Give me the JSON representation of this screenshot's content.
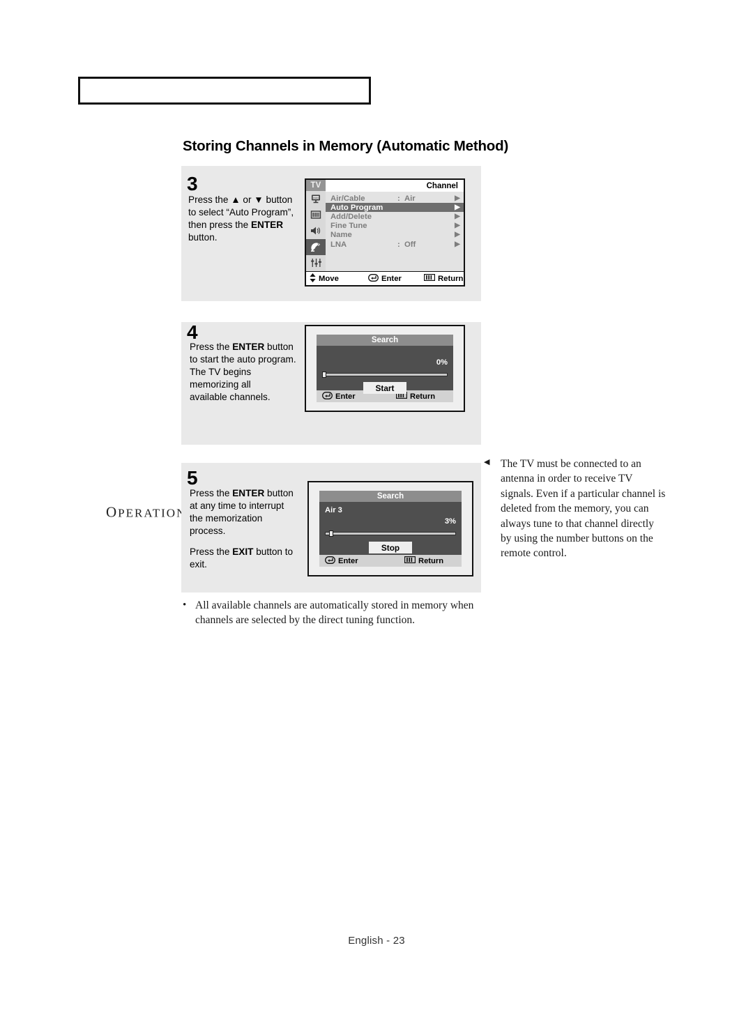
{
  "chapter": {
    "label": "OPERATION",
    "first_letter": "O",
    "rest": "PERATION"
  },
  "section": {
    "heading": "Storing Channels in Memory (Automatic Method)"
  },
  "steps": [
    {
      "number": "3",
      "lines": [
        "Press the ▲ or ▼ button",
        "to select “Auto Program”,",
        "then press the ENTER",
        "button."
      ]
    },
    {
      "number": "4",
      "lines": [
        "Press the ENTER button",
        "to start the auto program.",
        "The TV begins",
        "memorizing all",
        "available channels."
      ]
    },
    {
      "number": "5",
      "lines": [
        "Press the ENTER button",
        "at any time to interrupt",
        "the memorization",
        "process.",
        "",
        "Press the EXIT button to",
        "exit."
      ]
    }
  ],
  "osd_channel": {
    "tv_tag": "TV",
    "title": "Channel",
    "sidebar_icons": [
      "input-source-icon",
      "picture-icon",
      "sound-icon",
      "channel-dish-icon",
      "setup-sliders-icon"
    ],
    "selected_icon_index": 3,
    "rows": [
      {
        "label": "Air/Cable",
        "colon": ":",
        "value": "Air",
        "arrow": "▶",
        "highlighted": false
      },
      {
        "label": "Auto Program",
        "colon": "",
        "value": "",
        "arrow": "▶",
        "highlighted": true
      },
      {
        "label": "Add/Delete",
        "colon": "",
        "value": "",
        "arrow": "▶",
        "highlighted": false
      },
      {
        "label": "Fine Tune",
        "colon": "",
        "value": "",
        "arrow": "▶",
        "highlighted": false
      },
      {
        "label": "Name",
        "colon": "",
        "value": "",
        "arrow": "▶",
        "highlighted": false
      },
      {
        "label": "LNA",
        "colon": ":",
        "value": "Off",
        "arrow": "▶",
        "highlighted": false
      }
    ],
    "footer": {
      "move": "Move",
      "enter": "Enter",
      "return": "Return"
    }
  },
  "osd_search_start": {
    "title": "Search",
    "channel": "",
    "percent": "0%",
    "progress_value": 0,
    "button": "Start",
    "footer": {
      "enter": "Enter",
      "return": "Return"
    }
  },
  "osd_search_stop": {
    "title": "Search",
    "channel": "Air 3",
    "percent": "3%",
    "progress_value": 3,
    "button": "Stop",
    "footer": {
      "enter": "Enter",
      "return": "Return"
    }
  },
  "note_right": {
    "marker": "◀",
    "text": "The TV must be connected to an antenna in order to receive TV signals. Even if a particular channel is deleted from the memory, you can always tune to that channel directly by using the number buttons on the remote control."
  },
  "note_bullet": {
    "marker": "•",
    "text": "All available channels are automatically stored in memory when channels are selected by the direct tuning function."
  },
  "footer": {
    "page_label": "English - 23"
  },
  "colors": {
    "panel_bg": "#e9e9e9",
    "osd_bg": "#e3e3e3",
    "osd_highlight": "#6e6e6e",
    "osd_label": "#7d7d7d",
    "search_body": "#4f4f4f",
    "search_title": "#8d8d8d",
    "search_footer": "#d2d2d2",
    "tv_tag": "#949494"
  }
}
